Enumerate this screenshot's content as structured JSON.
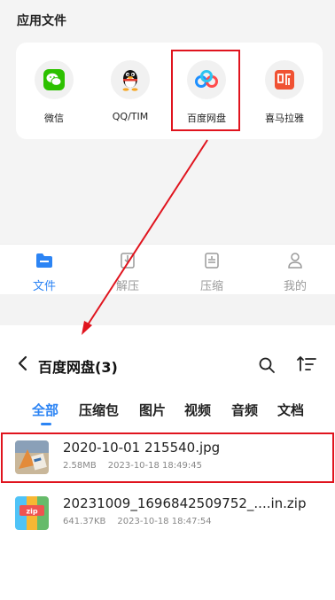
{
  "apps_section": {
    "title": "应用文件",
    "apps": [
      {
        "label": "微信",
        "icon": "wechat-icon"
      },
      {
        "label": "QQ/TIM",
        "icon": "qq-penguin-icon"
      },
      {
        "label": "百度网盘",
        "icon": "baidu-netdisk-icon"
      },
      {
        "label": "喜马拉雅",
        "icon": "ximalaya-icon"
      }
    ]
  },
  "bottom_nav": [
    {
      "label": "文件",
      "icon": "folder-icon",
      "active": true
    },
    {
      "label": "解压",
      "icon": "unzip-icon",
      "active": false
    },
    {
      "label": "压缩",
      "icon": "compress-icon",
      "active": false
    },
    {
      "label": "我的",
      "icon": "person-icon",
      "active": false
    }
  ],
  "folder_view": {
    "title": "百度网盘(3)",
    "tabs": [
      "全部",
      "压缩包",
      "图片",
      "视频",
      "音频",
      "文档"
    ],
    "active_tab": "全部",
    "files": [
      {
        "name": "2020-10-01 215540.jpg",
        "size": "2.58MB",
        "date": "2023-10-18 18:49:45",
        "icon": "image-thumbnail"
      },
      {
        "name": "20231009_1696842509752_....in.zip",
        "size": "641.37KB",
        "date": "2023-10-18 18:47:54",
        "icon": "zip-icon"
      }
    ]
  },
  "colors": {
    "accent": "#2c84f4",
    "highlight": "#e0141e",
    "wechat": "#2dc100",
    "ximalaya": "#f05233"
  }
}
